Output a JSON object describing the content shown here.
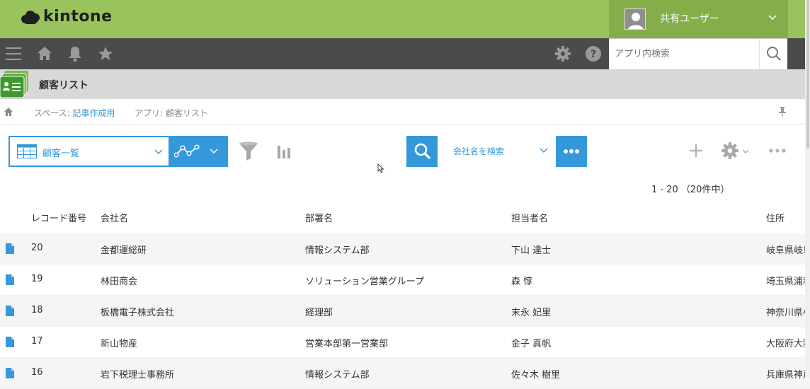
{
  "header": {
    "logo_text": "kintone",
    "user_name": "共有ユーザー",
    "brand_color": "#9ac25d"
  },
  "navbar": {
    "search_placeholder": "アプリ内検索",
    "icons": [
      "menu-icon",
      "home-icon",
      "bell-icon",
      "star-icon",
      "gear-icon",
      "help-icon",
      "search-icon"
    ]
  },
  "app": {
    "title": "顧客リスト"
  },
  "breadcrumb": {
    "space_prefix": "スペース: ",
    "space_link": "記事作成用",
    "app_prefix": "アプリ: ",
    "app_name": "顧客リスト"
  },
  "toolbar": {
    "view_label": "顧客一覧",
    "field_select_label": "会社名を検索",
    "accent_color": "#3498db"
  },
  "record_count": "1 - 20 （20件中）",
  "table": {
    "headers": [
      "レコード番号",
      "会社名",
      "部署名",
      "担当者名",
      "住所"
    ],
    "rows": [
      {
        "id": "20",
        "company": "金都運総研",
        "dept": "情報システム部",
        "person": "下山 達士",
        "address": "岐阜県岐阜"
      },
      {
        "id": "19",
        "company": "林田商会",
        "dept": "ソリューション営業グループ",
        "person": "森 惇",
        "address": "埼玉県浦和"
      },
      {
        "id": "18",
        "company": "板橋電子株式会社",
        "dept": "経理部",
        "person": "末永 妃里",
        "address": "神奈川県小"
      },
      {
        "id": "17",
        "company": "新山物産",
        "dept": "営業本部第一営業部",
        "person": "金子 真帆",
        "address": "大阪府大阪"
      },
      {
        "id": "16",
        "company": "岩下税理士事務所",
        "dept": "情報システム部",
        "person": "佐々木 樹里",
        "address": "兵庫県神戸"
      }
    ]
  }
}
